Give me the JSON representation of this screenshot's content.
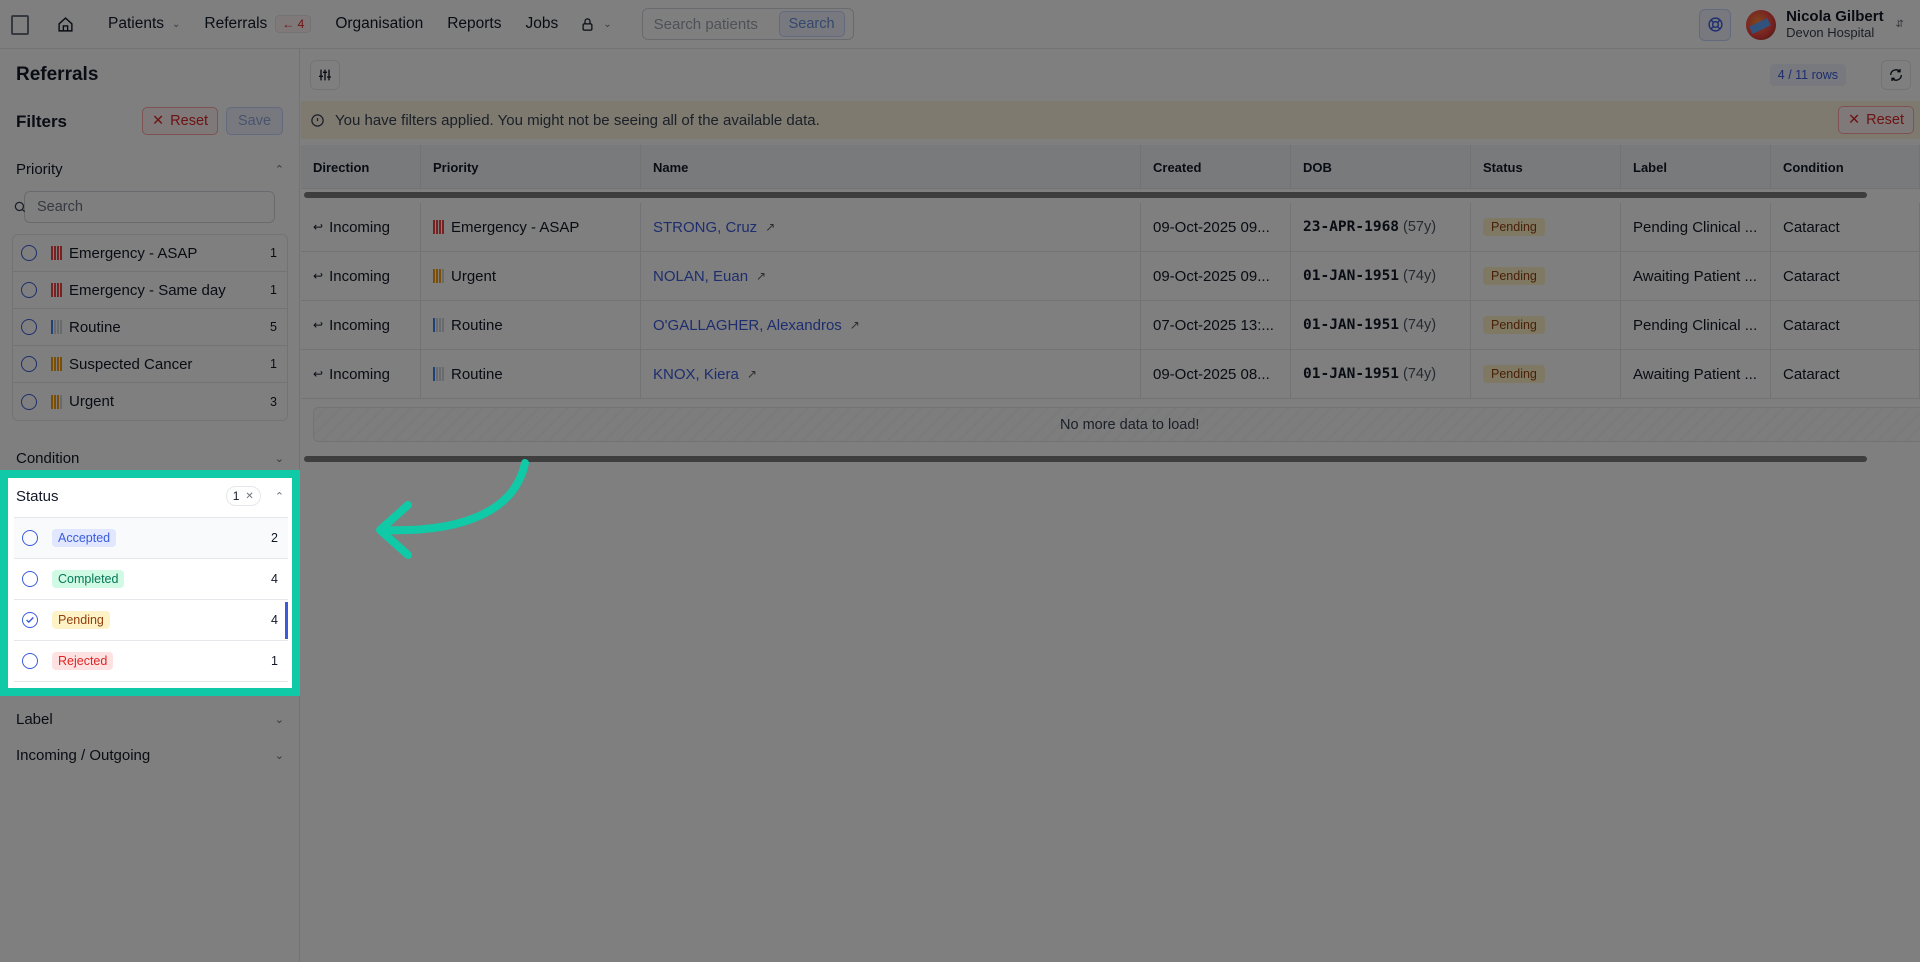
{
  "topbar": {
    "nav": {
      "patients": "Patients",
      "referrals": "Referrals",
      "referrals_badge": "← 4",
      "organisation": "Organisation",
      "reports": "Reports",
      "jobs": "Jobs"
    },
    "search": {
      "placeholder": "Search patients",
      "button": "Search"
    },
    "user": {
      "name": "Nicola Gilbert",
      "org": "Devon Hospital"
    }
  },
  "sidebar": {
    "title": "Referrals",
    "filters_title": "Filters",
    "reset_label": "Reset",
    "save_label": "Save",
    "priority": {
      "title": "Priority",
      "search_placeholder": "Search",
      "items": [
        {
          "label": "Emergency - ASAP",
          "count": "1",
          "color": "#ef4444",
          "fill": 4
        },
        {
          "label": "Emergency - Same day",
          "count": "1",
          "color": "#ef4444",
          "fill": 4
        },
        {
          "label": "Routine",
          "count": "5",
          "color": "#3b82f6",
          "fill": 1
        },
        {
          "label": "Suspected Cancer",
          "count": "1",
          "color": "#f59e0b",
          "fill": 4
        },
        {
          "label": "Urgent",
          "count": "3",
          "color": "#f59e0b",
          "fill": 3
        }
      ]
    },
    "condition": {
      "title": "Condition"
    },
    "status": {
      "title": "Status",
      "selected_count": "1",
      "items": [
        {
          "label": "Accepted",
          "count": "2",
          "bg": "#e0e7ff",
          "fg": "#3b5bdb",
          "checked": false
        },
        {
          "label": "Completed",
          "count": "4",
          "bg": "#d1fae5",
          "fg": "#047857",
          "checked": false
        },
        {
          "label": "Pending",
          "count": "4",
          "bg": "#fef3c7",
          "fg": "#92400e",
          "checked": true
        },
        {
          "label": "Rejected",
          "count": "1",
          "bg": "#fee2e2",
          "fg": "#dc2626",
          "checked": false
        }
      ]
    },
    "label": {
      "title": "Label"
    },
    "incoming_outgoing": {
      "title": "Incoming / Outgoing"
    }
  },
  "main": {
    "rows_label": "4 / 11 rows",
    "banner": "You have filters applied. You might not be seeing all of the available data.",
    "banner_reset": "Reset",
    "columns": [
      "Direction",
      "Priority",
      "Name",
      "Created",
      "DOB",
      "Status",
      "Label",
      "Condition"
    ],
    "rows": [
      {
        "direction": "Incoming",
        "priority": "Emergency - ASAP",
        "priority_color": "#ef4444",
        "priority_fill": 4,
        "name": "STRONG, Cruz",
        "created": "09-Oct-2025 09...",
        "dob": "23-APR-1968",
        "age": "(57y)",
        "status": "Pending",
        "label": "Pending Clinical ...",
        "condition": "Cataract"
      },
      {
        "direction": "Incoming",
        "priority": "Urgent",
        "priority_color": "#f59e0b",
        "priority_fill": 3,
        "name": "NOLAN, Euan",
        "created": "09-Oct-2025 09...",
        "dob": "01-JAN-1951",
        "age": "(74y)",
        "status": "Pending",
        "label": "Awaiting Patient ...",
        "condition": "Cataract"
      },
      {
        "direction": "Incoming",
        "priority": "Routine",
        "priority_color": "#3b82f6",
        "priority_fill": 1,
        "name": "O'GALLAGHER, Alexandros",
        "created": "07-Oct-2025 13:...",
        "dob": "01-JAN-1951",
        "age": "(74y)",
        "status": "Pending",
        "label": "Pending Clinical ...",
        "condition": "Cataract"
      },
      {
        "direction": "Incoming",
        "priority": "Routine",
        "priority_color": "#3b82f6",
        "priority_fill": 1,
        "name": "KNOX, Kiera",
        "created": "09-Oct-2025 08...",
        "dob": "01-JAN-1951",
        "age": "(74y)",
        "status": "Pending",
        "label": "Awaiting Patient ...",
        "condition": "Cataract"
      }
    ],
    "no_more": "No more data to load!"
  },
  "colors": {
    "highlight": "#10c9a6",
    "accent": "#3b5bdb"
  }
}
